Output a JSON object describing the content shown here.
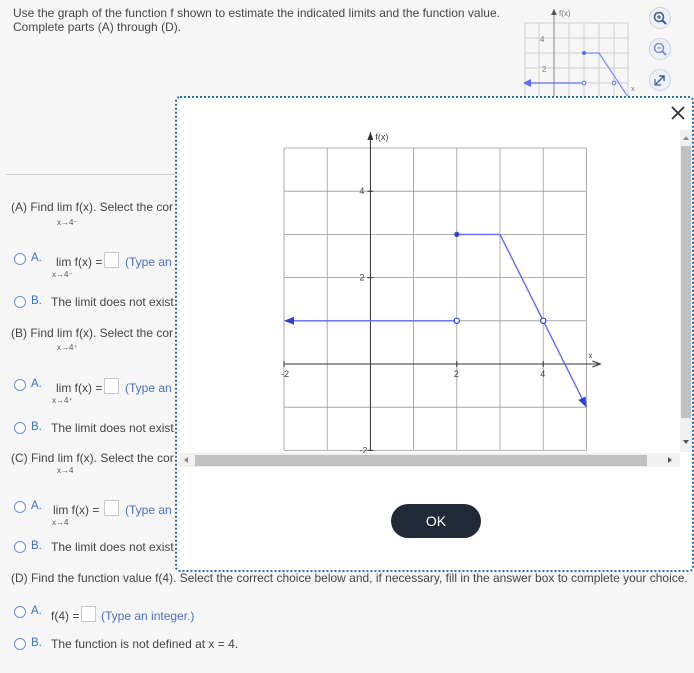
{
  "instructions": "Use the graph of the function f shown to estimate the indicated limits and the function value. Complete parts (A) through (D).",
  "parts": [
    {
      "label": "(A) Find  lim f(x). Select the cor",
      "sub": "x→4⁻"
    },
    {
      "label": "(B) Find  lim f(x). Select the cor",
      "sub": "x→4⁺"
    },
    {
      "label": "(C) Find  lim  f(x). Select the cor",
      "sub": "x→4"
    },
    {
      "label": "(D) Find the function value f(4). Select the correct choice below and, if necessary, fill in the answer box to complete your choice."
    }
  ],
  "choices": {
    "a_letter": "A.",
    "b_letter": "B.",
    "A": {
      "a_text": "lim f(x) =",
      "a_sub": "x→4⁻",
      "a_hint": "(Type an i",
      "b_text": "The limit does not exist."
    },
    "B": {
      "a_text": "lim f(x) =",
      "a_sub": "x→4⁺",
      "a_hint": "(Type an i",
      "b_text": "The limit does not exist."
    },
    "C": {
      "a_text": "lim  f(x) =",
      "a_sub": "x→4",
      "a_hint": "(Type an i",
      "b_text": "The limit does not exist."
    },
    "D": {
      "a_text": "f(4) =",
      "a_hint": "(Type an integer.)",
      "b_text": "The function is not defined at x = 4."
    }
  },
  "graph": {
    "y_axis_label": "f(x)",
    "x_axis_label": "x",
    "x_ticks": [
      "-2",
      "2",
      "4"
    ],
    "y_ticks": [
      "4",
      "2",
      "-2"
    ],
    "xlim": [
      -2,
      5
    ],
    "ylim": [
      -2,
      5
    ],
    "segments": [
      {
        "kind": "ray-left",
        "y": 1,
        "from_x": 2,
        "end": "open"
      },
      {
        "points": [
          [
            2,
            3
          ],
          [
            3,
            3
          ],
          [
            5,
            -1
          ]
        ],
        "start": "closed",
        "end": "arrow"
      }
    ],
    "open_points": [
      [
        2,
        1
      ],
      [
        4,
        1
      ]
    ],
    "closed_points": [
      [
        2,
        3
      ]
    ]
  },
  "thumb_graph": {
    "y_label": "f(x)",
    "tick_4": "4",
    "tick_2": "2",
    "x_label": "x"
  },
  "modal": {
    "ok_label": "OK",
    "close_symbol": "✕"
  },
  "colors": {
    "curve": "#5b6cf0",
    "accent": "#2a6ea8",
    "ok_bg": "#1f2a36"
  }
}
